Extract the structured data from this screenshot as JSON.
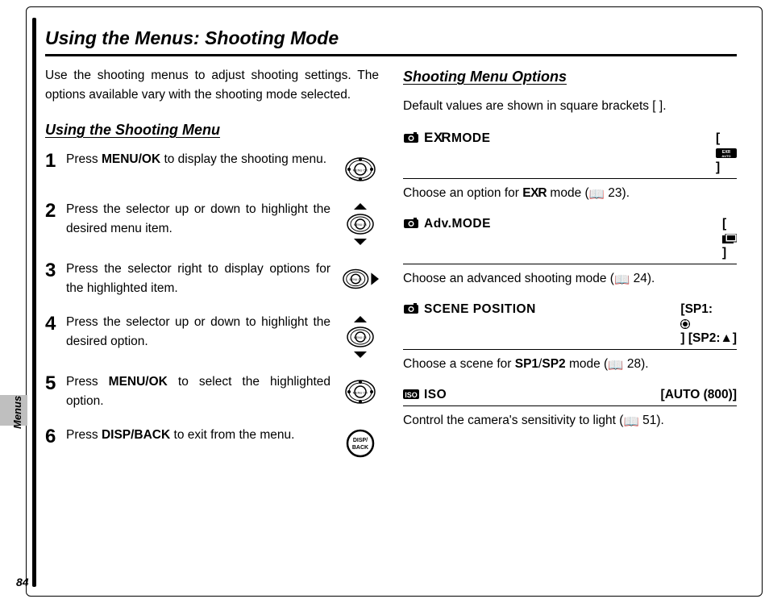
{
  "title": "Using the Menus: Shooting Mode",
  "intro": "Use the shooting menus to adjust shooting settings.  The options available vary with the shooting mode selected.",
  "left": {
    "heading": "Using the Shooting Menu",
    "steps": [
      {
        "num": "1",
        "pre": "Press ",
        "bold": "MENU/OK",
        "post": " to display the shooting menu.",
        "icon": "selector-center"
      },
      {
        "num": "2",
        "pre": "Press the selector up or down to highlight the desired menu item.",
        "bold": "",
        "post": "",
        "icon": "selector-updown"
      },
      {
        "num": "3",
        "pre": "Press the selector right to display options for the highlighted item.",
        "bold": "",
        "post": "",
        "icon": "selector-right"
      },
      {
        "num": "4",
        "pre": "Press the selector up or down to highlight the desired option.",
        "bold": "",
        "post": "",
        "icon": "selector-updown"
      },
      {
        "num": "5",
        "pre": "Press ",
        "bold": "MENU/OK",
        "post": " to select the highlighted option.",
        "icon": "selector-center"
      },
      {
        "num": "6",
        "pre": "Press ",
        "bold": "DISP/BACK",
        "post": " to exit from the menu.",
        "icon": "disp-back"
      }
    ]
  },
  "right": {
    "heading": "Shooting Menu Options",
    "intro": "Default values are shown in square brackets [ ].",
    "options": [
      {
        "icon": "camera-icon",
        "label_pre": "",
        "label_bold": "EXR",
        "label_post": " MODE",
        "default_pre": "[",
        "default_mid": "EXR AUTO",
        "default_post": "]",
        "body_pre": "Choose an option for ",
        "body_mid": "EXR",
        "body_post": " mode (",
        "page": "23",
        "body_end": ")."
      },
      {
        "icon": "camera-icon",
        "label_pre": " Adv. ",
        "label_bold": "MODE",
        "label_post": "",
        "default_pre": "[",
        "default_mid": "adv-icon",
        "default_post": "]",
        "body_pre": "Choose an advanced shooting mode (",
        "body_mid": "",
        "body_post": "",
        "page": "24",
        "body_end": ")."
      },
      {
        "icon": "camera-icon",
        "label_pre": " SCENE POSITION",
        "label_bold": "",
        "label_post": "",
        "default_pre": "[SP1:",
        "default_mid": "sp1",
        "default_post": "] [SP2:▲]",
        "body_pre": "Choose a scene for ",
        "body_mid": "SP1/SP2",
        "body_post": " mode (",
        "page": "28",
        "body_end": ")."
      },
      {
        "icon": "iso-icon",
        "label_pre": " ISO",
        "label_bold": "",
        "label_post": "",
        "default_pre": "[AUTO (800)]",
        "default_mid": "",
        "default_post": "",
        "body_pre": "Control the camera's sensitivity to light (",
        "body_mid": "",
        "body_post": "",
        "page": "51",
        "body_end": ")."
      }
    ]
  },
  "side_tab": "Menus",
  "page_number": "84"
}
